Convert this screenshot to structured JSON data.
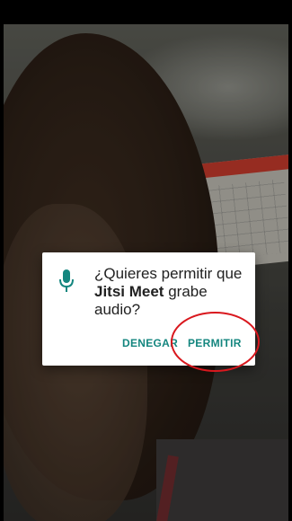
{
  "dialog": {
    "message_prefix": "¿Quieres permitir que ",
    "app_name": "Jitsi Meet",
    "message_suffix": " grabe audio?",
    "deny_label": "DENEGAR",
    "allow_label": "PERMITIR"
  },
  "icons": {
    "permission": "microphone-icon"
  },
  "colors": {
    "accent": "#14867f",
    "annotation": "#d9181e"
  }
}
